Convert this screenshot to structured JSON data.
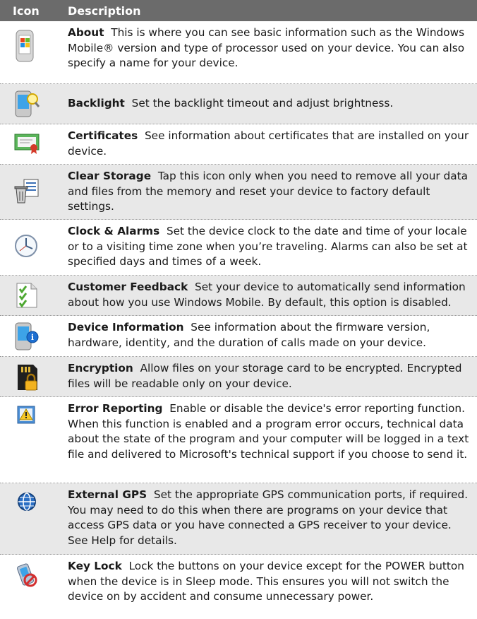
{
  "header": {
    "icon_col": "Icon",
    "desc_col": "Description"
  },
  "rows": [
    {
      "icon": "about-icon",
      "title": "About",
      "text": "This is where you can see basic information such as the Windows Mobile® version and type of processor used on your device. You can also specify a name for your device."
    },
    {
      "icon": "backlight-icon",
      "title": "Backlight",
      "text": "Set the backlight timeout and adjust brightness."
    },
    {
      "icon": "certificates-icon",
      "title": "Certificates",
      "text": "See information about certificates that are installed on your device."
    },
    {
      "icon": "clear-storage-icon",
      "title": "Clear Storage",
      "text": "Tap this icon only when you need to remove all your data and files from the memory and reset your device to factory default settings."
    },
    {
      "icon": "clock-icon",
      "title": "Clock & Alarms",
      "text": "Set the device clock to the date and time of your locale or to a visiting time zone when you’re traveling. Alarms can also be set at specified days and times of a week."
    },
    {
      "icon": "customer-feedback-icon",
      "title": "Customer Feedback",
      "text": "Set your device to automatically send information about how you use Windows Mobile. By default, this option is disabled."
    },
    {
      "icon": "device-information-icon",
      "title": "Device Information",
      "text": "See information about the firmware version, hardware, identity, and the duration of calls made on your device."
    },
    {
      "icon": "encryption-icon",
      "title": "Encryption",
      "text": "Allow files on your storage card to be encrypted. Encrypted files will be readable only on your device."
    },
    {
      "icon": "error-reporting-icon",
      "title": "Error Reporting",
      "text": "Enable or disable the device's error reporting function. When this function is enabled and a program error occurs, technical data about the state of the program and your computer will be logged in a text file and delivered to Microsoft's technical support if you choose to send it."
    },
    {
      "icon": "external-gps-icon",
      "title": "External GPS",
      "text": "Set the appropriate GPS communication ports, if required. You may need to do this when there are programs on your device that access GPS data or you have connected a GPS receiver to your device. See Help for details."
    },
    {
      "icon": "key-lock-icon",
      "title": "Key Lock",
      "text": "Lock the buttons on your device except for the POWER button when the device is in Sleep mode. This ensures you will not switch the device on by accident and consume unnecessary power."
    }
  ]
}
